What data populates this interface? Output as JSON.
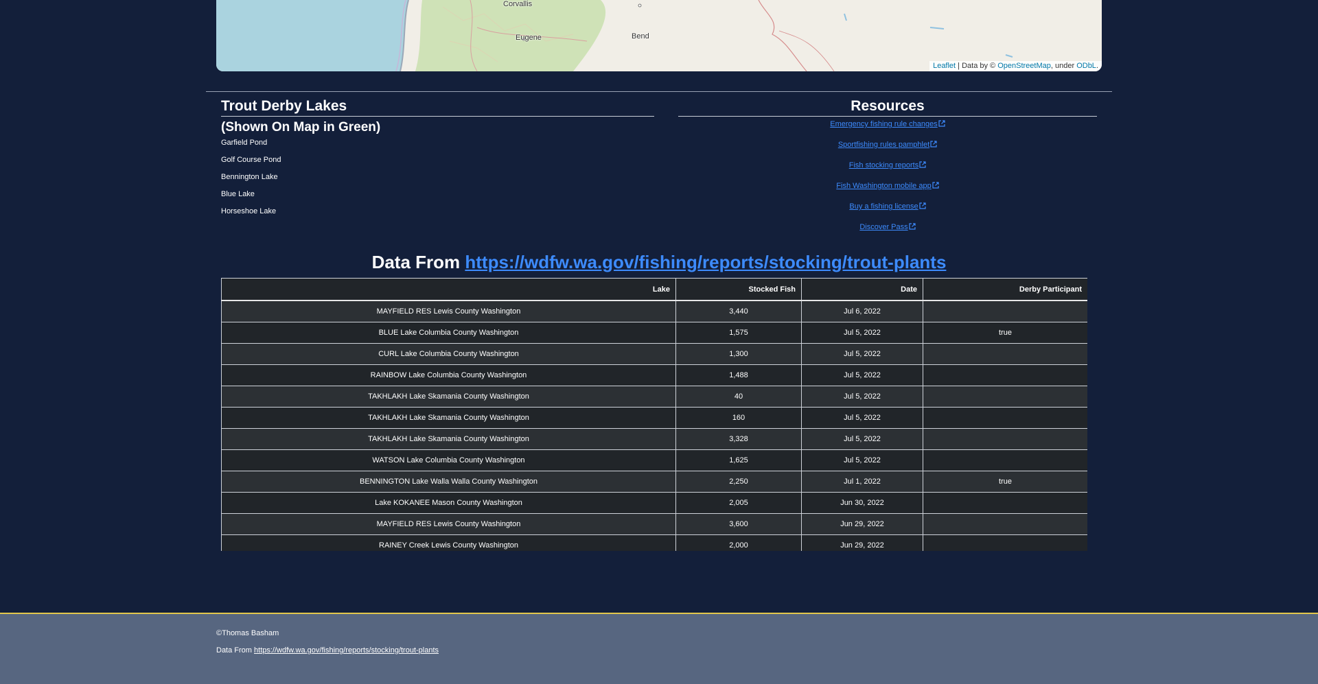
{
  "map": {
    "labels": [
      "Corvallis",
      "Eugene",
      "Bend"
    ],
    "attribution": {
      "leaflet": "Leaflet",
      "sep": " | Data by © ",
      "osm": "OpenStreetMap",
      "under": ", under ",
      "odbl": "ODbL",
      "end": "."
    }
  },
  "derby": {
    "title": "Trout Derby Lakes",
    "subtitle": "(Shown On Map in Green)",
    "lakes": [
      "Garfield Pond",
      "Golf Course Pond",
      "Bennington Lake",
      "Blue Lake",
      "Horseshoe Lake"
    ]
  },
  "resources": {
    "title": "Resources",
    "links": [
      "Emergency fishing rule changes",
      "Sportfishing rules pamphlet",
      "Fish stocking reports",
      "Fish Washington mobile app",
      "Buy a fishing license",
      "Discover Pass"
    ]
  },
  "data_source": {
    "prefix": "Data From ",
    "url": "https://wdfw.wa.gov/fishing/reports/stocking/trout-plants"
  },
  "table": {
    "headers": [
      "Lake",
      "Stocked Fish",
      "Date",
      "Derby Participant"
    ],
    "rows": [
      [
        "MAYFIELD RES Lewis County Washington",
        "3,440",
        "Jul 6, 2022",
        ""
      ],
      [
        "BLUE Lake Columbia County Washington",
        "1,575",
        "Jul 5, 2022",
        "true"
      ],
      [
        "CURL Lake Columbia County Washington",
        "1,300",
        "Jul 5, 2022",
        ""
      ],
      [
        "RAINBOW Lake Columbia County Washington",
        "1,488",
        "Jul 5, 2022",
        ""
      ],
      [
        "TAKHLAKH Lake Skamania County Washington",
        "40",
        "Jul 5, 2022",
        ""
      ],
      [
        "TAKHLAKH Lake Skamania County Washington",
        "160",
        "Jul 5, 2022",
        ""
      ],
      [
        "TAKHLAKH Lake Skamania County Washington",
        "3,328",
        "Jul 5, 2022",
        ""
      ],
      [
        "WATSON Lake Columbia County Washington",
        "1,625",
        "Jul 5, 2022",
        ""
      ],
      [
        "BENNINGTON Lake Walla Walla County Washington",
        "2,250",
        "Jul 1, 2022",
        "true"
      ],
      [
        "Lake KOKANEE Mason County Washington",
        "2,005",
        "Jun 30, 2022",
        ""
      ],
      [
        "MAYFIELD RES Lewis County Washington",
        "3,600",
        "Jun 29, 2022",
        ""
      ],
      [
        "RAINEY Creek Lewis County Washington",
        "2,000",
        "Jun 29, 2022",
        ""
      ]
    ]
  },
  "footer": {
    "copyright": "©Thomas Basham",
    "source_prefix": "Data From ",
    "source_url": "https://wdfw.wa.gov/fishing/reports/stocking/trout-plants"
  }
}
